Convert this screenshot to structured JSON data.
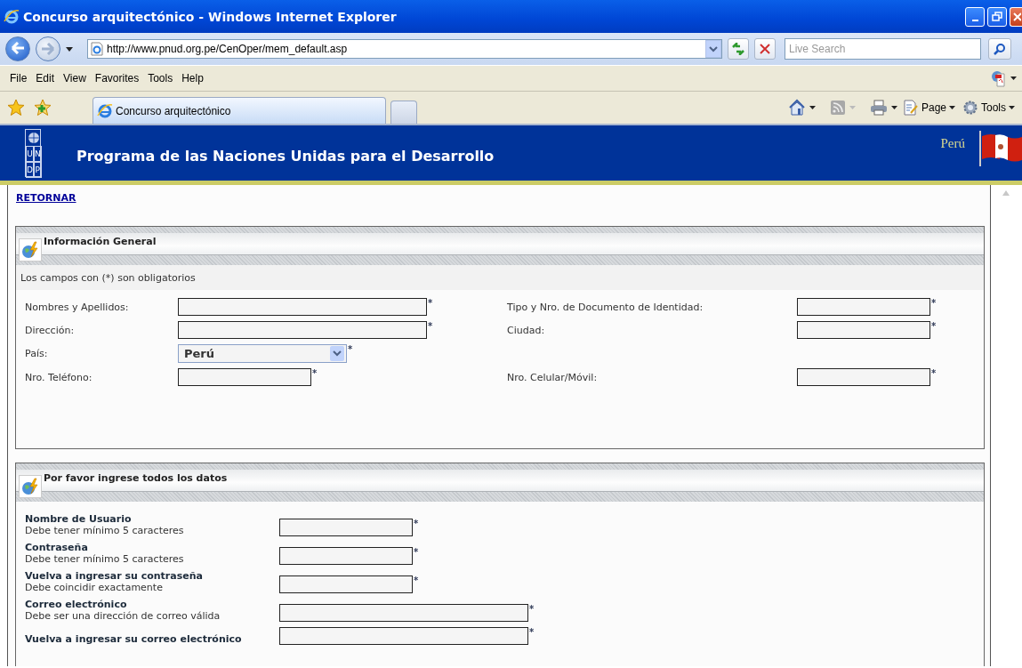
{
  "window": {
    "title": "Concurso arquitectónico - Windows Internet Explorer"
  },
  "browser": {
    "address": "http://www.pnud.org.pe/CenOper/mem_default.asp",
    "search_placeholder": "Live Search",
    "menu": [
      "File",
      "Edit",
      "View",
      "Favorites",
      "Tools",
      "Help"
    ],
    "tab_title": "Concurso arquitectónico",
    "commands": [
      "Page",
      "Tools"
    ]
  },
  "page_header": {
    "title": "Programa de las Naciones Unidas para el Desarrollo",
    "country": "Perú",
    "logo_letters": [
      "U",
      "N",
      "D",
      "P"
    ]
  },
  "back_link": "RETORNAR",
  "general_section": {
    "title": "Información General",
    "note": "Los campos con (*) son obligatorios",
    "rows": [
      {
        "left": {
          "label": "Nombres y Apellidos:",
          "kind": "wide",
          "required_mark": "*"
        },
        "right": {
          "label": "Tipo y Nro. de Documento de Identidad:",
          "kind": "narrow",
          "required_mark": "*"
        }
      },
      {
        "left": {
          "label": "Dirección:",
          "kind": "wide",
          "required_mark": "*"
        },
        "right": {
          "label": "Ciudad:",
          "kind": "narrow",
          "required_mark": "*"
        }
      },
      {
        "left": {
          "label": "País:",
          "kind": "select",
          "value": "Perú",
          "required_mark": "*"
        }
      },
      {
        "left": {
          "label": "Nro. Teléfono:",
          "kind": "narrow",
          "required_mark": "*"
        },
        "right": {
          "label": "Nro. Celular/Móvil:",
          "kind": "narrow",
          "required_mark": "*"
        }
      }
    ]
  },
  "account_section": {
    "title": "Por favor ingrese todos los datos",
    "fields": [
      {
        "label": "Nombre de Usuario",
        "hint": "Debe tener mínimo 5 caracteres",
        "kind": "narrow",
        "required_mark": "*"
      },
      {
        "label": "Contraseña",
        "hint": "Debe tener mínimo 5 caracteres",
        "kind": "narrow",
        "required_mark": "*"
      },
      {
        "label": "Vuelva a ingresar su contraseña",
        "hint": "Debe coincidir exactamente",
        "kind": "narrow",
        "required_mark": "*"
      },
      {
        "label": "Correo electrónico",
        "hint": "Debe ser una dirección de correo válida",
        "kind": "wide",
        "required_mark": "*"
      },
      {
        "label": "Vuelva a ingresar su correo electrónico",
        "kind": "wide",
        "required_mark": "*"
      }
    ]
  }
}
